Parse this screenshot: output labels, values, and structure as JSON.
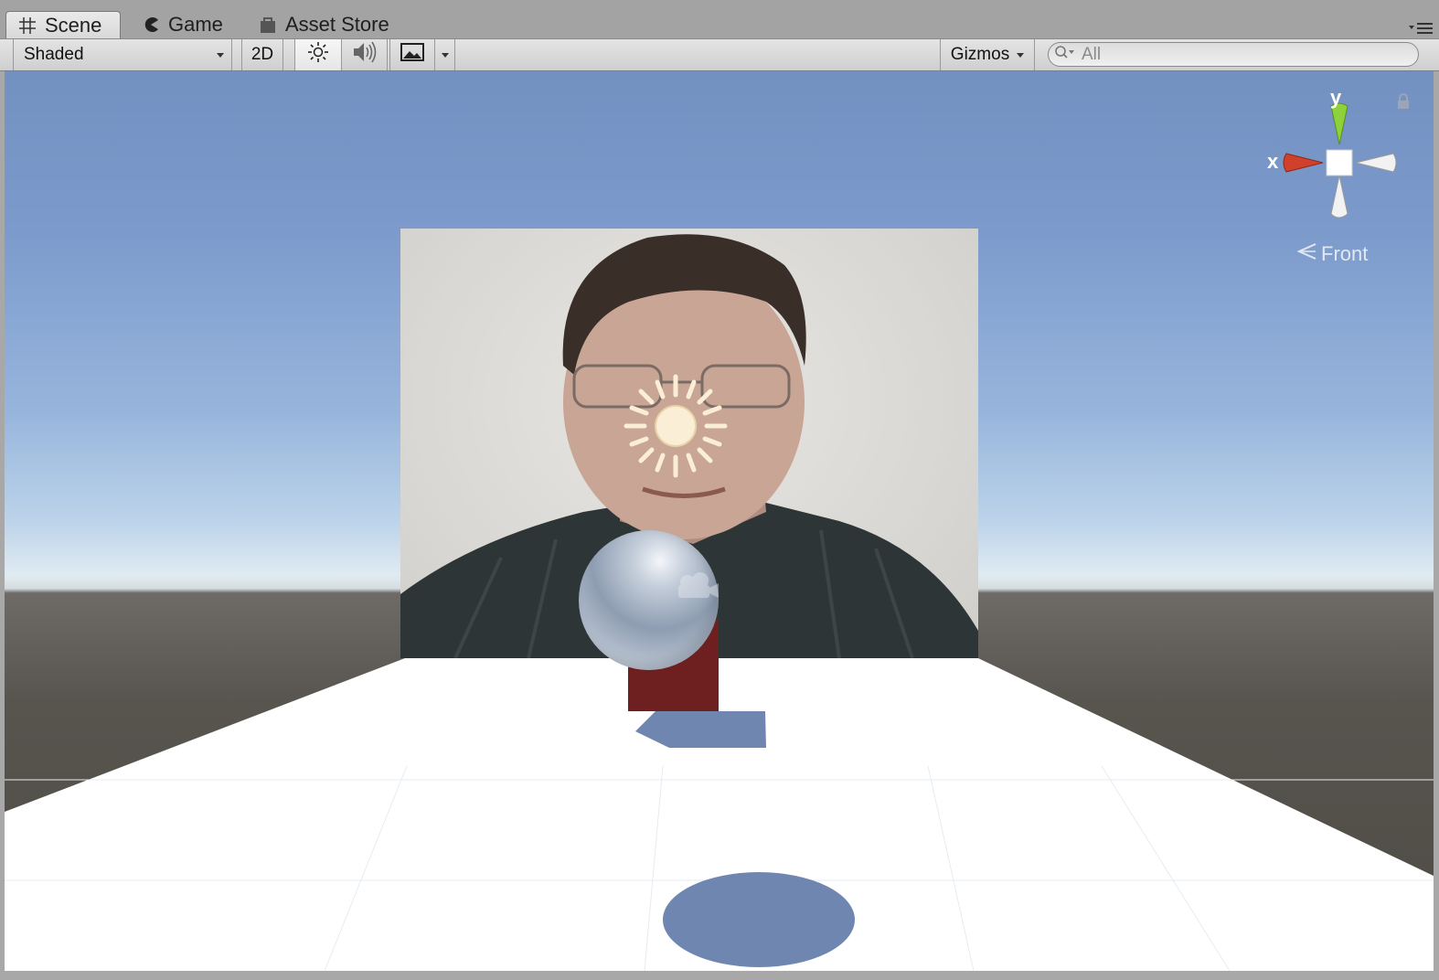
{
  "tabs": [
    {
      "label": "Scene",
      "icon": "grid-icon"
    },
    {
      "label": "Game",
      "icon": "pacman-icon"
    },
    {
      "label": "Asset Store",
      "icon": "bag-icon"
    }
  ],
  "toolbar": {
    "draw_mode": "Shaded",
    "mode_2d": "2D",
    "gizmos": "Gizmos",
    "search_placeholder": "All"
  },
  "gizmo": {
    "y_label": "y",
    "x_label": "x",
    "view_label": "Front"
  },
  "colors": {
    "x_axis": "#d0402a",
    "y_axis": "#8dd23a",
    "sky": "#7c9bcc",
    "ground": "#58554f",
    "cube": "#6e1f1f",
    "shadow": "#6f87b0"
  }
}
